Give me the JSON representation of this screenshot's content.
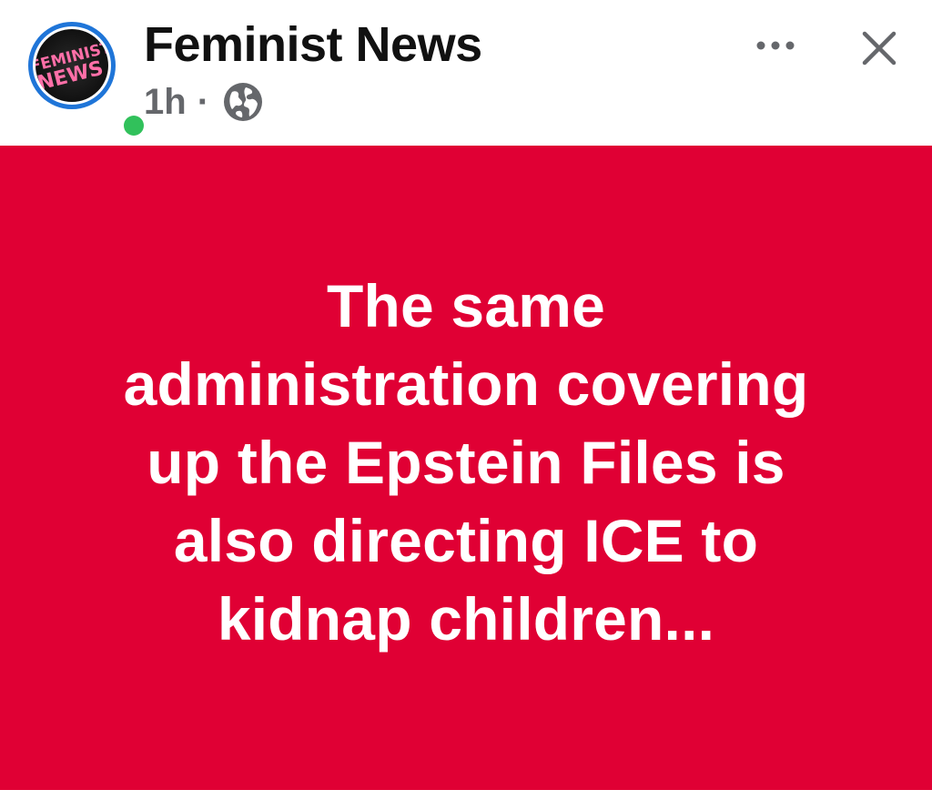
{
  "post": {
    "page_name": "Feminist News",
    "time": "1h",
    "separator": "·",
    "audience_icon": "globe-icon",
    "avatar_logo": "FEMINIST NEWS",
    "online": true,
    "body_lines": [
      "The same",
      "administration covering",
      "up the Epstein Files is",
      "also directing ICE to",
      "kidnap children..."
    ]
  },
  "actions": {
    "more_icon": "more-options-icon",
    "close_icon": "close-icon"
  },
  "colors": {
    "card_background": "#e00034",
    "card_text": "#ffffff",
    "online_indicator": "#31c15b",
    "avatar_ring": "#1f75d8",
    "meta_text": "#65676b"
  }
}
